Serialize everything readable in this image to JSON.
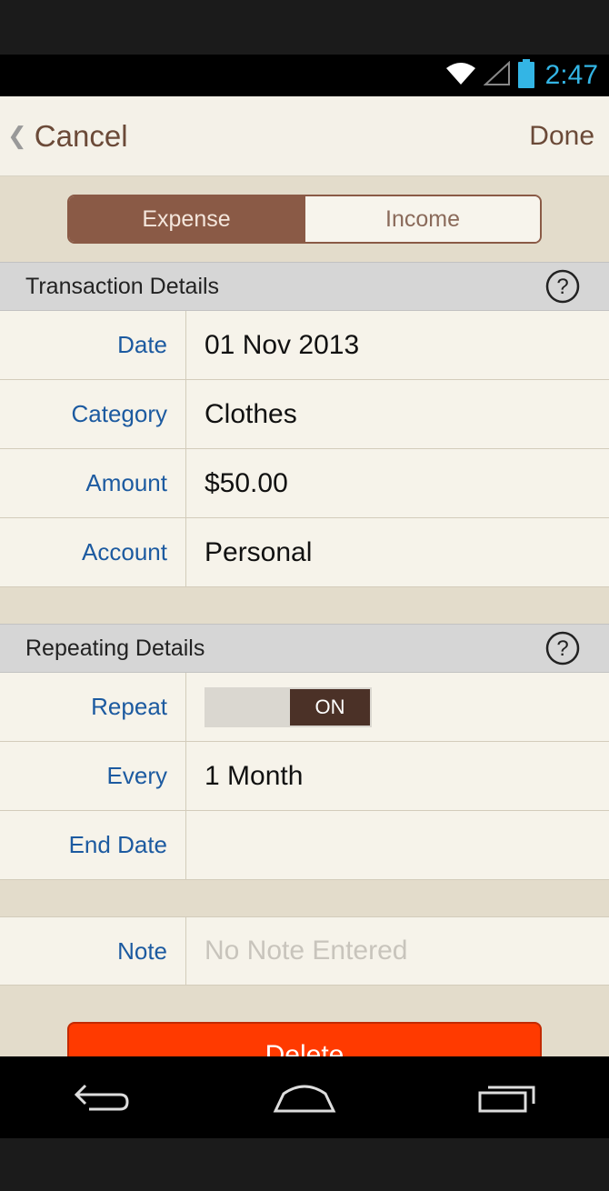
{
  "status_bar": {
    "time": "2:47",
    "icons": [
      "wifi-icon",
      "signal-icon",
      "battery-icon"
    ],
    "accent_color": "#33b5e5"
  },
  "nav": {
    "cancel_label": "Cancel",
    "done_label": "Done"
  },
  "segment": {
    "options": [
      "Expense",
      "Income"
    ],
    "selected": "Expense"
  },
  "transaction_section": {
    "title": "Transaction Details",
    "rows": [
      {
        "label": "Date",
        "value": "01 Nov 2013"
      },
      {
        "label": "Category",
        "value": "Clothes"
      },
      {
        "label": "Amount",
        "value": "$50.00"
      },
      {
        "label": "Account",
        "value": "Personal"
      }
    ]
  },
  "repeating_section": {
    "title": "Repeating Details",
    "repeat_label": "Repeat",
    "repeat_toggle": "ON",
    "every_label": "Every",
    "every_value": "1 Month",
    "end_date_label": "End Date",
    "end_date_value": ""
  },
  "note": {
    "label": "Note",
    "placeholder": "No Note Entered"
  },
  "delete_label": "Delete",
  "colors": {
    "brand_brown": "#8a5a46",
    "label_blue": "#1c5aa0",
    "delete_red": "#ff3a00"
  }
}
